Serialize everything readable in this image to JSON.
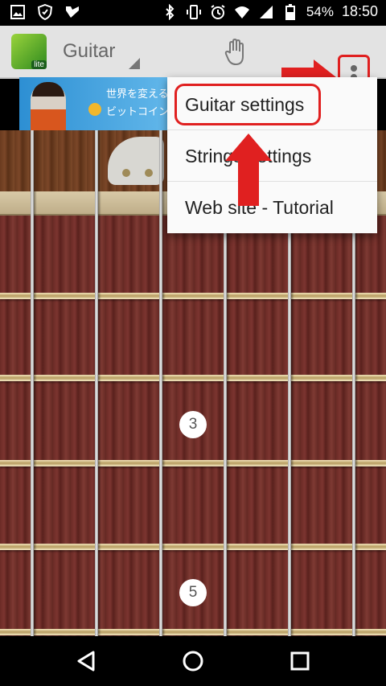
{
  "status_bar": {
    "battery": "54%",
    "time": "18:50",
    "icons": [
      "image-icon",
      "shield-icon",
      "check-icon",
      "bluetooth-icon",
      "vibrate-icon",
      "alarm-icon",
      "wifi-icon",
      "signal-icon",
      "battery-icon"
    ]
  },
  "action_bar": {
    "app_icon_badge": "lite",
    "title": "Guitar",
    "icons": [
      "hand-icon",
      "overflow-menu-icon"
    ]
  },
  "ad": {
    "line1": "世界を変えるコ",
    "line2": "ビットコインは"
  },
  "menu": {
    "items": [
      {
        "label": "Guitar settings"
      },
      {
        "label": "Strings settings"
      },
      {
        "label": "Web site - Tutorial"
      }
    ]
  },
  "fretboard": {
    "markers": [
      "3",
      "5"
    ]
  },
  "nav_bar": {
    "icons": [
      "back-icon",
      "home-icon",
      "recents-icon"
    ]
  },
  "annotation_colors": {
    "highlight": "#e02020",
    "arrow": "#e02020"
  }
}
